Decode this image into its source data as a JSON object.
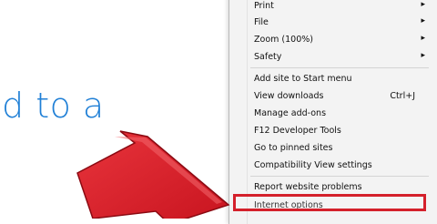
{
  "page": {
    "text": "d to a"
  },
  "menu": {
    "items": [
      {
        "id": "print",
        "label": "Print",
        "submenu": true
      },
      {
        "id": "file",
        "label": "File",
        "submenu": true
      },
      {
        "id": "zoom",
        "label": "Zoom (100%)",
        "submenu": true
      },
      {
        "id": "safety",
        "label": "Safety",
        "submenu": true
      },
      {
        "id": "add-site",
        "label": "Add site to Start menu"
      },
      {
        "id": "view-downloads",
        "label": "View downloads",
        "shortcut": "Ctrl+J"
      },
      {
        "id": "manage-addons",
        "label": "Manage add-ons"
      },
      {
        "id": "f12-tools",
        "label": "F12 Developer Tools"
      },
      {
        "id": "pinned-sites",
        "label": "Go to pinned sites"
      },
      {
        "id": "compat-view",
        "label": "Compatibility View settings"
      },
      {
        "id": "report-problems",
        "label": "Report website problems"
      },
      {
        "id": "internet-options",
        "label": "Internet options"
      }
    ],
    "submenu_glyph": "▸"
  },
  "annotation": {
    "arrow_color": "#d4202b",
    "highlight_color": "#d4202b"
  }
}
